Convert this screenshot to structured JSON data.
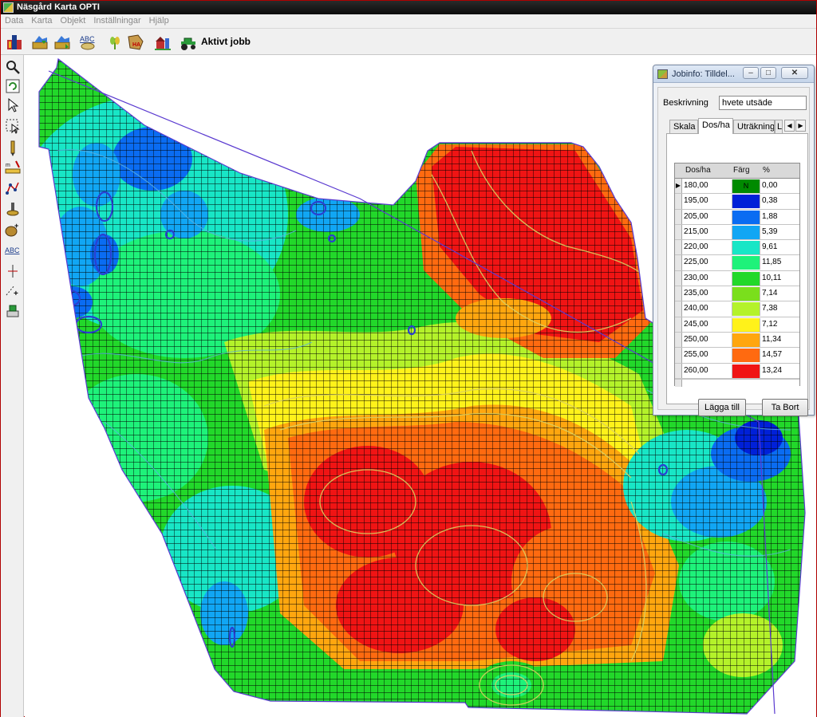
{
  "window": {
    "title": "Näsgård Karta OPTI"
  },
  "menu": [
    "Data",
    "Karta",
    "Objekt",
    "Inställningar",
    "Hjälp"
  ],
  "toolbar": {
    "active_job_label": "Aktivt jobb",
    "buttons": [
      "job-icon",
      "open-map-icon",
      "save-map-icon",
      "abc-text-icon",
      "crop-icon",
      "area-ha-icon",
      "farm-icon",
      "tractor-icon"
    ]
  },
  "toolbox": [
    "zoom-icon",
    "refresh-icon",
    "pointer-icon",
    "select-area-icon",
    "pen-icon",
    "measure-icon",
    "polyline-icon",
    "sample-point-icon",
    "add-object-icon",
    "abc-label-icon",
    "marker-icon",
    "add-point-icon",
    "stamp-icon"
  ],
  "jobinfo": {
    "title": "Jobinfo: Tilldel...",
    "description_label": "Beskrivning",
    "description_value": "hvete utsäde",
    "tabs": [
      "Skala",
      "Dos/ha",
      "Uträkning",
      "L"
    ],
    "active_tab": "Dos/ha",
    "table": {
      "headers": {
        "dose": "Dos/ha",
        "color": "Färg",
        "percent": "%"
      },
      "rows": [
        {
          "dose": "180,00",
          "color": "#008a00",
          "mark": "N",
          "percent": "0,00"
        },
        {
          "dose": "195,00",
          "color": "#0020d8",
          "mark": "",
          "percent": "0,38"
        },
        {
          "dose": "205,00",
          "color": "#0a6cf2",
          "mark": "",
          "percent": "1,88"
        },
        {
          "dose": "215,00",
          "color": "#11a6f4",
          "mark": "",
          "percent": "5,39"
        },
        {
          "dose": "220,00",
          "color": "#18e6c6",
          "mark": "",
          "percent": "9,61"
        },
        {
          "dose": "225,00",
          "color": "#1ef27a",
          "mark": "",
          "percent": "11,85"
        },
        {
          "dose": "230,00",
          "color": "#22d82a",
          "mark": "",
          "percent": "10,11"
        },
        {
          "dose": "235,00",
          "color": "#7adf1c",
          "mark": "",
          "percent": "7,14"
        },
        {
          "dose": "240,00",
          "color": "#b4f22a",
          "mark": "",
          "percent": "7,38"
        },
        {
          "dose": "245,00",
          "color": "#fff21a",
          "mark": "",
          "percent": "7,12"
        },
        {
          "dose": "250,00",
          "color": "#ffa60f",
          "mark": "",
          "percent": "11,34"
        },
        {
          "dose": "255,00",
          "color": "#ff6a10",
          "mark": "",
          "percent": "14,57"
        },
        {
          "dose": "260,00",
          "color": "#f01414",
          "mark": "",
          "percent": "13,24"
        }
      ]
    },
    "add_button": "Lägga till",
    "remove_button": "Ta Bort"
  }
}
